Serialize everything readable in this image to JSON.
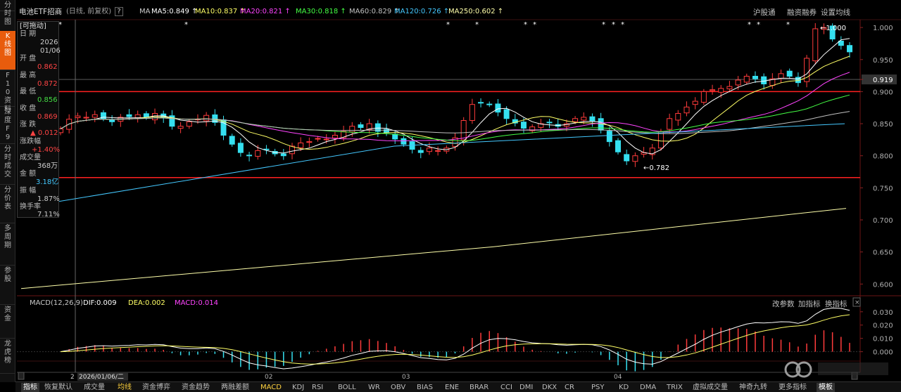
{
  "left_nav": [
    {
      "label": "分时图"
    },
    {
      "label": "K线图",
      "active": true
    },
    {
      "label": "F10资料"
    },
    {
      "label": "深度F9"
    },
    {
      "label": "分时成交"
    },
    {
      "label": "分价表"
    },
    {
      "label": "多周期"
    },
    {
      "label": "参股"
    },
    {
      "label": "资金"
    },
    {
      "label": "龙虎榜"
    }
  ],
  "header": {
    "stock_name": "电池ETF招商",
    "period": "(日线, 前复权)",
    "help": "?",
    "ma_label": "MA",
    "ma_items": [
      {
        "text": "MA5:0.849",
        "color": "#ffffff"
      },
      {
        "text": "MA10:0.837",
        "color": "#ffff66"
      },
      {
        "text": "MA20:0.821",
        "color": "#ff44ff"
      },
      {
        "text": "MA30:0.818",
        "color": "#44ff44"
      },
      {
        "text": "MA60:0.829",
        "color": "#c0c0c0"
      },
      {
        "text": "MA120:0.726",
        "color": "#44c8ff"
      },
      {
        "text": "MA250:0.602",
        "color": "#ffffaa"
      }
    ],
    "right_buttons": [
      "沪股通",
      "融资融券",
      "设置均线"
    ]
  },
  "info_box": {
    "draggable": "[可拖动]",
    "date_label": "日 期",
    "year": "2026",
    "date": "01/06",
    "open_label": "开 盘",
    "open": "0.862",
    "high_label": "最 高",
    "high": "0.872",
    "low_label": "最 低",
    "low": "0.856",
    "close_label": "收 盘",
    "close": "0.869",
    "change_label": "涨 跌",
    "change": "▲ 0.012",
    "change_pct_label": "涨跌幅",
    "change_pct": "+1.40%",
    "volume_label": "成交量",
    "volume": "368万",
    "amount_label": "金 额",
    "amount": "3.18亿",
    "amplitude_label": "振 幅",
    "amplitude": "1.87%",
    "turnover_label": "换手率",
    "turnover": "7.11%"
  },
  "price_axis": [
    "1.000",
    "0.950",
    "0.919",
    "0.900",
    "0.850",
    "0.800",
    "0.750",
    "0.700",
    "0.650",
    "0.600"
  ],
  "price_marks": {
    "current": "0.919",
    "max_label": "1.000",
    "min_label": "0.782"
  },
  "month_labels": [
    "02",
    "03",
    "04"
  ],
  "cursor_date": "2026/01/06/二",
  "cursor_x_label": "2",
  "macd": {
    "title": "MACD(12,26,9)",
    "dif": "DIF:0.009",
    "dea": "DEA:0.002",
    "macd": "MACD:0.014",
    "buttons": [
      "改参数",
      "加指标",
      "换指标"
    ],
    "axis": [
      "0.030",
      "0.020",
      "0.010",
      "0.000"
    ]
  },
  "bottom_tabs": [
    "指标",
    "恢复默认",
    "成交量",
    "均线",
    "资金博弈",
    "资金趋势",
    "两融差额",
    "MACD",
    "KDJ",
    "RSI",
    "BOLL",
    "WR",
    "OBV",
    "BIAS",
    "ENE",
    "BRAR",
    "CCI",
    "DMI",
    "DKX",
    "CR",
    "PSY",
    "KD",
    "DMA",
    "TRIX",
    "虚拟成交量",
    "神奇九转",
    "更多指标",
    "模板"
  ],
  "colors": {
    "up": "#ff3b3b",
    "down": "#35e0f0",
    "accent": "#e85c0d",
    "ma5": "#ffffff",
    "ma10": "#ffff66",
    "ma20": "#ff44ff",
    "ma30": "#44ff44",
    "ma60": "#c0c0c0",
    "ma120": "#44c8ff",
    "ma250": "#ffffaa"
  },
  "chart_data": {
    "type": "candlestick",
    "ylim": [
      0.585,
      1.01
    ],
    "closes": [
      0.842,
      0.857,
      0.862,
      0.86,
      0.864,
      0.858,
      0.853,
      0.86,
      0.861,
      0.864,
      0.86,
      0.866,
      0.86,
      0.846,
      0.846,
      0.853,
      0.857,
      0.863,
      0.852,
      0.832,
      0.818,
      0.805,
      0.8,
      0.808,
      0.81,
      0.803,
      0.8,
      0.815,
      0.82,
      0.822,
      0.827,
      0.826,
      0.832,
      0.838,
      0.846,
      0.844,
      0.85,
      0.838,
      0.836,
      0.826,
      0.818,
      0.81,
      0.805,
      0.812,
      0.808,
      0.812,
      0.828,
      0.855,
      0.88,
      0.883,
      0.88,
      0.868,
      0.858,
      0.851,
      0.843,
      0.845,
      0.85,
      0.852,
      0.846,
      0.85,
      0.858,
      0.86,
      0.854,
      0.84,
      0.822,
      0.806,
      0.792,
      0.8,
      0.805,
      0.812,
      0.838,
      0.858,
      0.866,
      0.876,
      0.885,
      0.9,
      0.903,
      0.905,
      0.908,
      0.918,
      0.924,
      0.92,
      0.912,
      0.92,
      0.928,
      0.924,
      0.914,
      0.952,
      0.998,
      1.0,
      0.982,
      0.972,
      0.962
    ],
    "swing_high": 1.0,
    "swing_low": 0.782
  }
}
